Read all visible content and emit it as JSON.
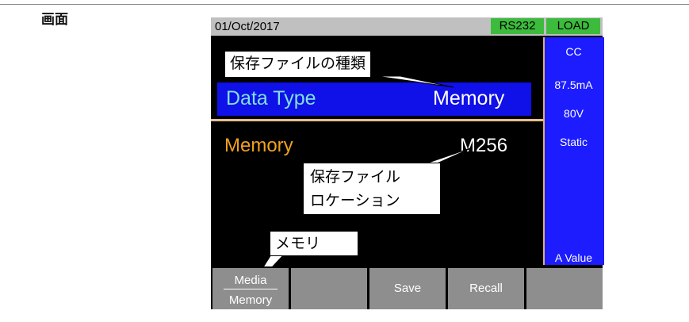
{
  "page": {
    "label": "画面"
  },
  "status": {
    "date": "01/Oct/2017",
    "rs232": "RS232",
    "load": "LOAD"
  },
  "side": {
    "mode": "CC",
    "current": "87.5mA",
    "voltage": "80V",
    "response": "Static",
    "bottom": "A Value"
  },
  "main": {
    "data_type_label": "Data Type",
    "data_type_value": "Memory",
    "memory_label": "Memory",
    "memory_value": "M256"
  },
  "callouts": {
    "file_type": "保存ファイルの種類",
    "location_line1": "保存ファイル",
    "location_line2": "ロケーション",
    "memory": "メモリ"
  },
  "softkeys": {
    "key1_top": "Media",
    "key1_bottom": "Memory",
    "key2": "",
    "key3": "Save",
    "key4": "Recall",
    "key5": ""
  },
  "colors": {
    "accent_blue": "#1010e8",
    "status_green": "#3dbb3d",
    "label_orange": "#f0a020",
    "label_cyan": "#7fe0e0"
  }
}
